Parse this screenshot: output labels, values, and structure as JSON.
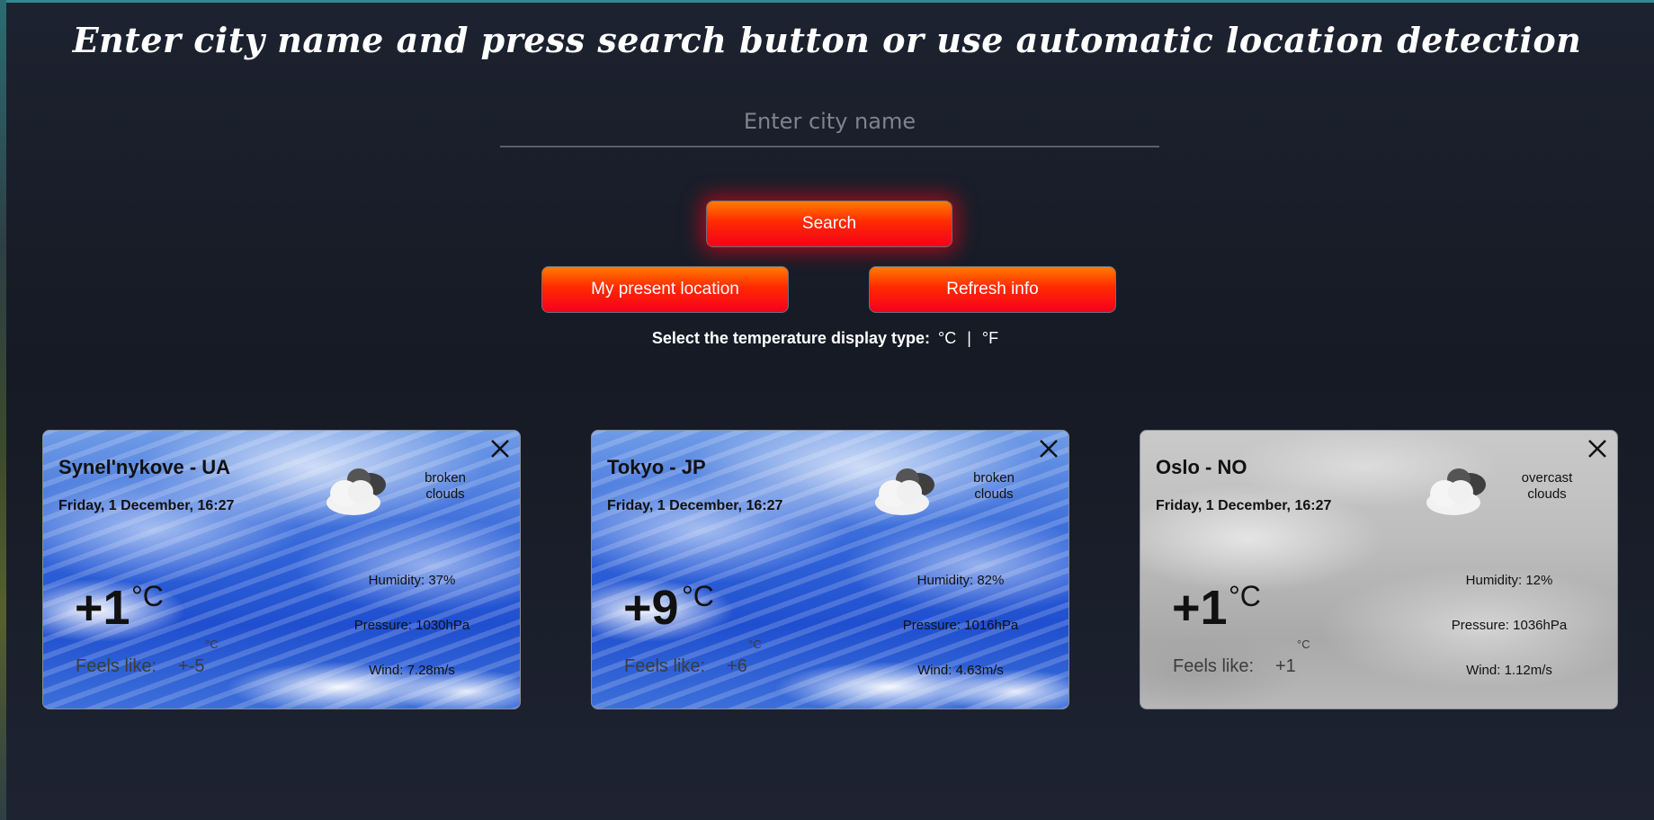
{
  "page": {
    "heading": "Enter city name and press search button or use automatic location detection"
  },
  "search": {
    "placeholder": "Enter city name",
    "value": ""
  },
  "buttons": {
    "search": "Search",
    "my_location": "My present location",
    "refresh": "Refresh info"
  },
  "temp_selector": {
    "label": "Select the temperature display type:",
    "celsius": "°C",
    "separator": "|",
    "fahrenheit": "°F"
  },
  "cards": [
    {
      "city": "Synel'nykove - UA",
      "date": "Friday, 1 December, 16:27",
      "description_line1": "broken",
      "description_line2": "clouds",
      "temp": "+1",
      "temp_unit": "°C",
      "feels_label": "Feels like:",
      "feels_value": "+-5",
      "feels_unit": "°C",
      "humidity": "Humidity: 37%",
      "pressure": "Pressure: 1030hPa",
      "wind": "Wind: 7.28m/s",
      "icon": "broken-clouds-icon",
      "background": "blue-sky"
    },
    {
      "city": "Tokyo - JP",
      "date": "Friday, 1 December, 16:27",
      "description_line1": "broken",
      "description_line2": "clouds",
      "temp": "+9",
      "temp_unit": "°C",
      "feels_label": "Feels like:",
      "feels_value": "+6",
      "feels_unit": "°C",
      "humidity": "Humidity: 82%",
      "pressure": "Pressure: 1016hPa",
      "wind": "Wind: 4.63m/s",
      "icon": "broken-clouds-icon",
      "background": "blue-sky"
    },
    {
      "city": "Oslo - NO",
      "date": "Friday, 1 December, 16:27",
      "description_line1": "overcast",
      "description_line2": "clouds",
      "temp": "+1",
      "temp_unit": "°C",
      "feels_label": "Feels like:",
      "feels_value": "+1",
      "feels_unit": "°C",
      "humidity": "Humidity: 12%",
      "pressure": "Pressure: 1036hPa",
      "wind": "Wind: 1.12m/s",
      "icon": "overcast-clouds-icon",
      "background": "overcast-sky"
    }
  ],
  "colors": {
    "button_top": "#ff7b00",
    "button_bottom": "#f5001e",
    "page_background": "#1d2230"
  }
}
